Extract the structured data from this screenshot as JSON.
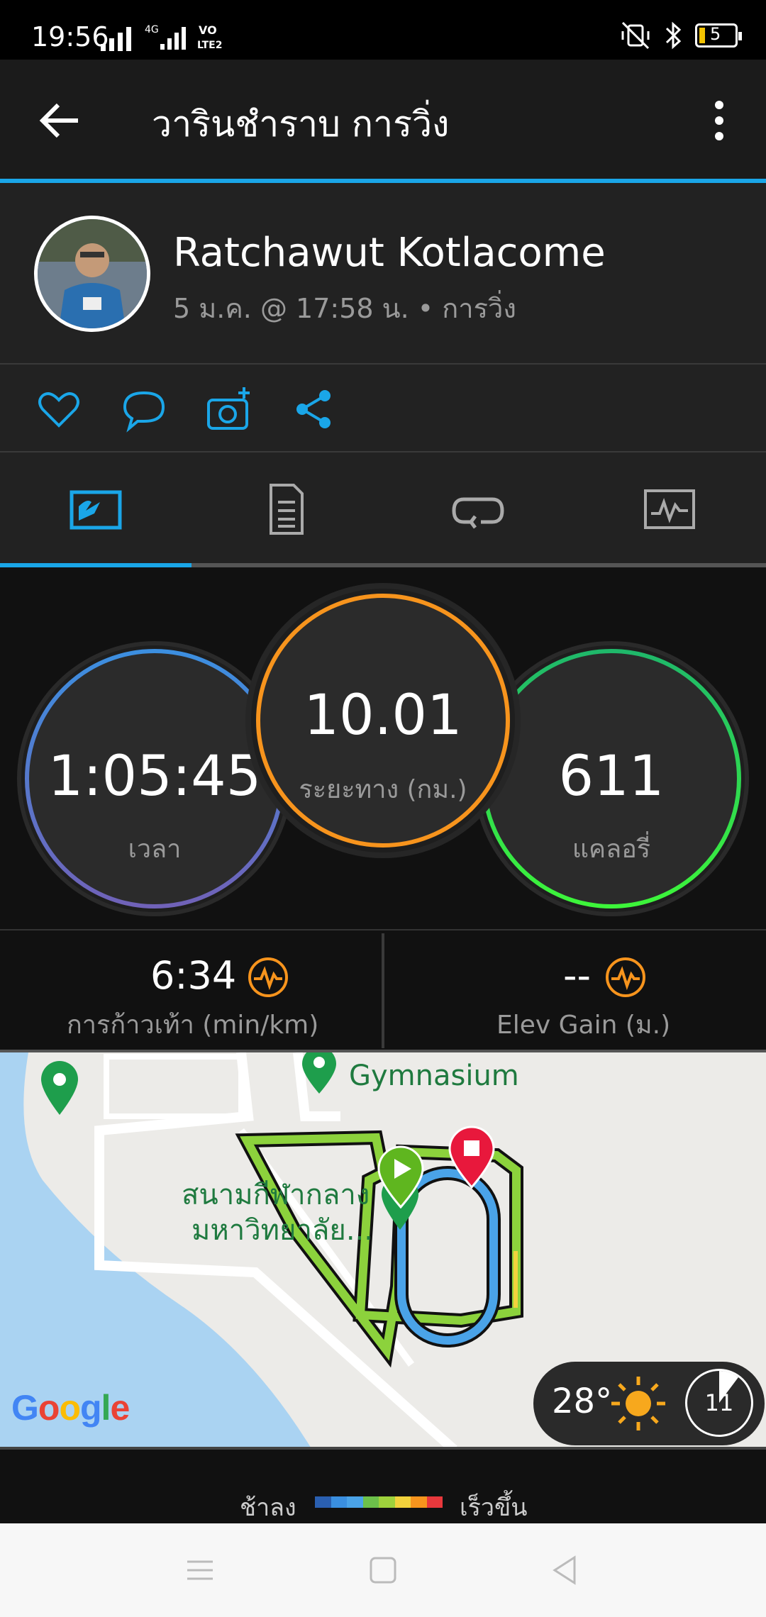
{
  "status_bar": {
    "time": "19:56",
    "network_label": "4G",
    "volte_label": "VO LTE2",
    "battery": "5"
  },
  "app_bar": {
    "title": "วารินชำราบ การวิ่ง"
  },
  "profile": {
    "name": "Ratchawut Kotlacome",
    "meta": "5 ม.ค. @ 17:58 น. • การวิ่ง"
  },
  "actions": [
    "heart-icon",
    "comment-icon",
    "camera-add-icon",
    "share-icon"
  ],
  "tabs": [
    {
      "name": "stats-tab",
      "selected": true
    },
    {
      "name": "details-tab",
      "selected": false
    },
    {
      "name": "laps-tab",
      "selected": false
    },
    {
      "name": "charts-tab",
      "selected": false
    }
  ],
  "rings": {
    "time": {
      "value": "1:05:45",
      "label": "เวลา"
    },
    "distance": {
      "value": "10.01",
      "label": "ระยะทาง (กม.)"
    },
    "calories": {
      "value": "611",
      "label": "แคลอรี่"
    }
  },
  "metrics": {
    "pace": {
      "value": "6:34",
      "label": "การก้าวเท้า (min/km)"
    },
    "elev_gain": {
      "value": "--",
      "label": "Elev Gain (ม.)"
    }
  },
  "map": {
    "poi_gym": "Gymnasium",
    "poi_stadium_line1": "สนามกีฬากลาง",
    "poi_stadium_line2": "มหาวิทยาลัย...",
    "google": "Google",
    "weather_temp": "28°",
    "wind_speed": "11"
  },
  "legend": {
    "slow": "ช้าลง",
    "fast": "เร็วขึ้น"
  },
  "colors": {
    "accent": "#1aa6e8",
    "time_ring": "#4a8fe0",
    "distance_ring": "#f7941d",
    "calories_ring": "#2ee06b",
    "route": "#8cd23c"
  }
}
